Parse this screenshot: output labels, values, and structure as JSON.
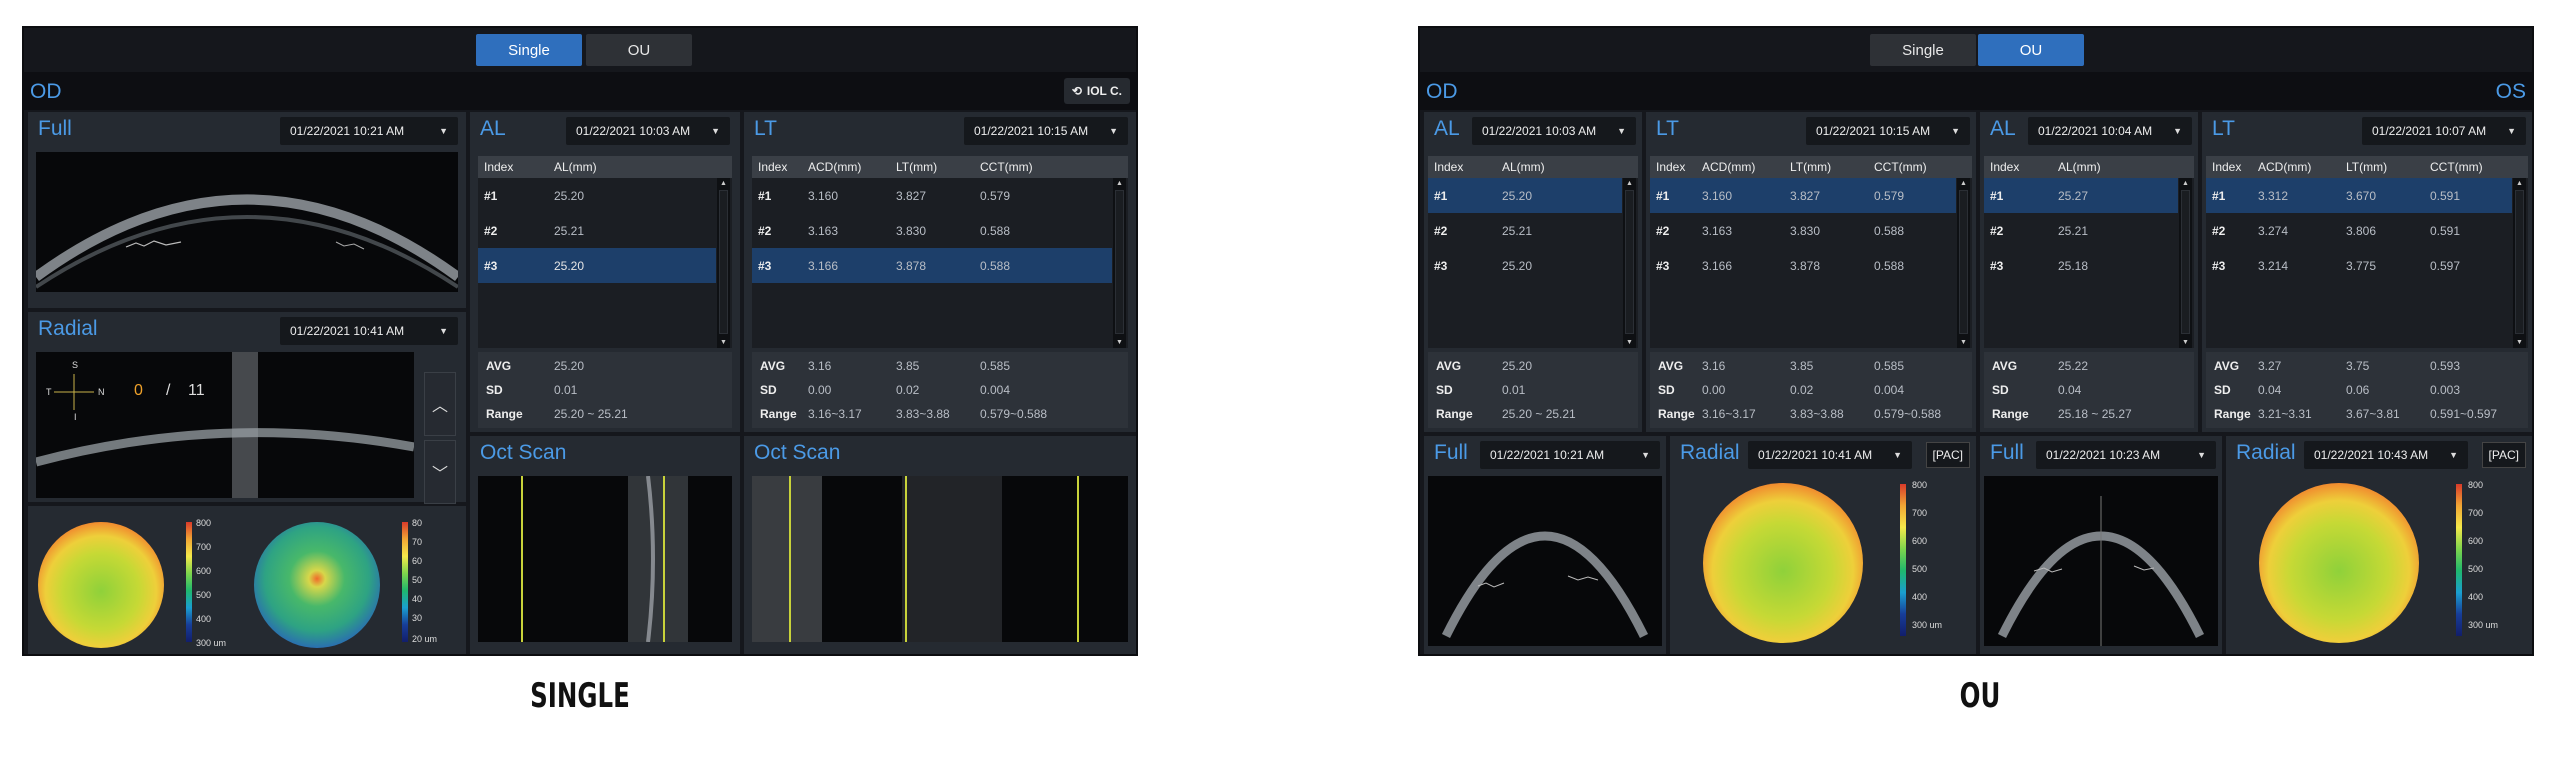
{
  "captions": {
    "single": "SINGLE",
    "ou": "OU"
  },
  "tabs": {
    "single": "Single",
    "ou": "OU"
  },
  "colors": {
    "accent": "#2f6fbd",
    "title_blue": "#4b9ae6",
    "selection_row": "#1d3f6a",
    "scan_marker": "#c8d23a"
  },
  "single": {
    "eye": "OD",
    "iol_button": "IOL C.",
    "full": {
      "title": "Full",
      "date": "01/22/2021 10:21 AM"
    },
    "radial": {
      "title": "Radial",
      "date": "01/22/2021 10:41 AM",
      "dir_s": "S",
      "dir_t": "T",
      "dir_n": "N",
      "dir_i": "I",
      "frame_current": "0",
      "frame_sep": "/",
      "frame_total": "11"
    },
    "maps": [
      {
        "labels": [
          "800",
          "700",
          "600",
          "500",
          "400",
          "300 um"
        ]
      },
      {
        "labels": [
          "80",
          "70",
          "60",
          "50",
          "40",
          "30",
          "20 um"
        ]
      }
    ],
    "al": {
      "title": "AL",
      "date": "01/22/2021 10:03 AM",
      "headers": [
        "Index",
        "AL(mm)"
      ],
      "rows": [
        [
          "#1",
          "25.20"
        ],
        [
          "#2",
          "25.21"
        ],
        [
          "#3",
          "25.20"
        ]
      ],
      "selected": 2,
      "stats": [
        [
          "AVG",
          "25.20"
        ],
        [
          "SD",
          "0.01"
        ],
        [
          "Range",
          "25.20 ~ 25.21"
        ]
      ]
    },
    "lt": {
      "title": "LT",
      "date": "01/22/2021 10:15 AM",
      "headers": [
        "Index",
        "ACD(mm)",
        "LT(mm)",
        "CCT(mm)"
      ],
      "rows": [
        [
          "#1",
          "3.160",
          "3.827",
          "0.579"
        ],
        [
          "#2",
          "3.163",
          "3.830",
          "0.588"
        ],
        [
          "#3",
          "3.166",
          "3.878",
          "0.588"
        ]
      ],
      "selected": 2,
      "stats": [
        [
          "AVG",
          "3.16",
          "3.85",
          "0.585"
        ],
        [
          "SD",
          "0.00",
          "0.02",
          "0.004"
        ],
        [
          "Range",
          "3.16~3.17",
          "3.83~3.88",
          "0.579~0.588"
        ]
      ]
    },
    "oct1": {
      "title": "Oct Scan"
    },
    "oct2": {
      "title": "Oct Scan"
    }
  },
  "ou": {
    "eye_left": "OD",
    "eye_right": "OS",
    "od_al": {
      "title": "AL",
      "date": "01/22/2021 10:03 AM",
      "headers": [
        "Index",
        "AL(mm)"
      ],
      "rows": [
        [
          "#1",
          "25.20"
        ],
        [
          "#2",
          "25.21"
        ],
        [
          "#3",
          "25.20"
        ]
      ],
      "selected": 0,
      "stats": [
        [
          "AVG",
          "25.20"
        ],
        [
          "SD",
          "0.01"
        ],
        [
          "Range",
          "25.20 ~ 25.21"
        ]
      ]
    },
    "od_lt": {
      "title": "LT",
      "date": "01/22/2021 10:15 AM",
      "headers": [
        "Index",
        "ACD(mm)",
        "LT(mm)",
        "CCT(mm)"
      ],
      "rows": [
        [
          "#1",
          "3.160",
          "3.827",
          "0.579"
        ],
        [
          "#2",
          "3.163",
          "3.830",
          "0.588"
        ],
        [
          "#3",
          "3.166",
          "3.878",
          "0.588"
        ]
      ],
      "selected": 0,
      "stats": [
        [
          "AVG",
          "3.16",
          "3.85",
          "0.585"
        ],
        [
          "SD",
          "0.00",
          "0.02",
          "0.004"
        ],
        [
          "Range",
          "3.16~3.17",
          "3.83~3.88",
          "0.579~0.588"
        ]
      ]
    },
    "os_al": {
      "title": "AL",
      "date": "01/22/2021 10:04 AM",
      "headers": [
        "Index",
        "AL(mm)"
      ],
      "rows": [
        [
          "#1",
          "25.27"
        ],
        [
          "#2",
          "25.21"
        ],
        [
          "#3",
          "25.18"
        ]
      ],
      "selected": 0,
      "stats": [
        [
          "AVG",
          "25.22"
        ],
        [
          "SD",
          "0.04"
        ],
        [
          "Range",
          "25.18 ~ 25.27"
        ]
      ]
    },
    "os_lt": {
      "title": "LT",
      "date": "01/22/2021 10:07 AM",
      "headers": [
        "Index",
        "ACD(mm)",
        "LT(mm)",
        "CCT(mm)"
      ],
      "rows": [
        [
          "#1",
          "3.312",
          "3.670",
          "0.591"
        ],
        [
          "#2",
          "3.274",
          "3.806",
          "0.591"
        ],
        [
          "#3",
          "3.214",
          "3.775",
          "0.597"
        ]
      ],
      "selected": 0,
      "stats": [
        [
          "AVG",
          "3.27",
          "3.75",
          "0.593"
        ],
        [
          "SD",
          "0.04",
          "0.06",
          "0.003"
        ],
        [
          "Range",
          "3.21~3.31",
          "3.67~3.81",
          "0.591~0.597"
        ]
      ]
    },
    "od_full": {
      "title": "Full",
      "date": "01/22/2021 10:21 AM"
    },
    "od_radial": {
      "title": "Radial",
      "date": "01/22/2021 10:41 AM",
      "pac": "[PAC]",
      "labels": [
        "800",
        "700",
        "600",
        "500",
        "400",
        "300 um"
      ]
    },
    "os_full": {
      "title": "Full",
      "date": "01/22/2021 10:23 AM"
    },
    "os_radial": {
      "title": "Radial",
      "date": "01/22/2021 10:43 AM",
      "pac": "[PAC]",
      "labels": [
        "800",
        "700",
        "600",
        "500",
        "400",
        "300 um"
      ]
    }
  }
}
